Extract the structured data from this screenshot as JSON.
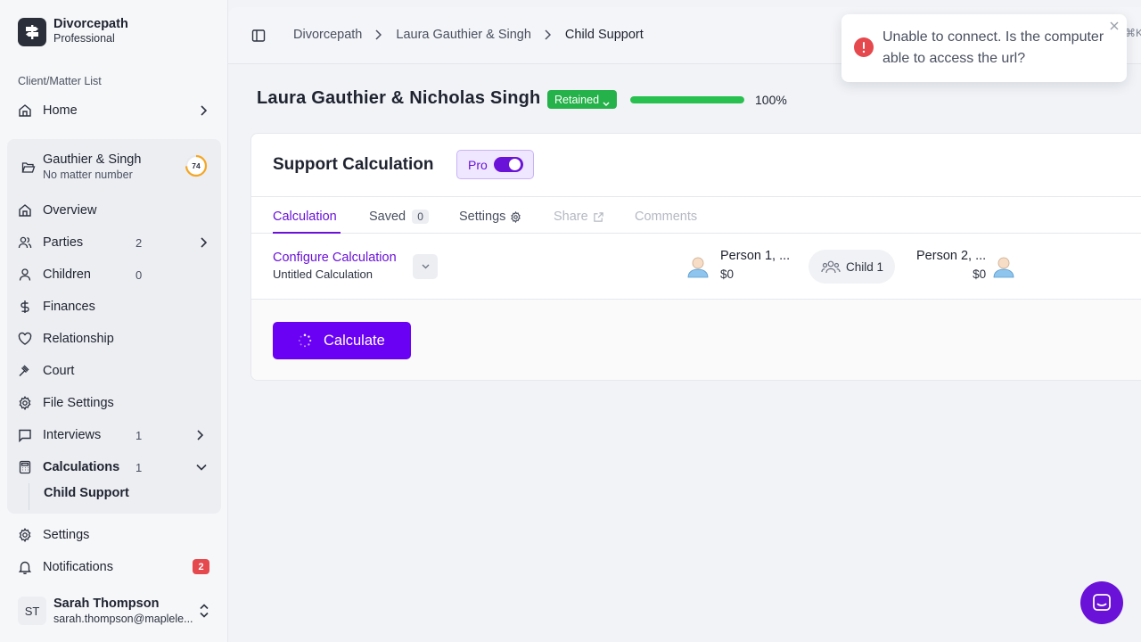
{
  "brand": {
    "name": "Divorcepath",
    "plan": "Professional"
  },
  "sidebar": {
    "section_label": "Client/Matter List",
    "home": "Home",
    "matter": {
      "title": "Gauthier & Singh",
      "subtitle": "No matter number",
      "progress_value": "74"
    },
    "items": [
      {
        "label": "Overview",
        "count": ""
      },
      {
        "label": "Parties",
        "count": "2"
      },
      {
        "label": "Children",
        "count": "0"
      },
      {
        "label": "Finances",
        "count": ""
      },
      {
        "label": "Relationship",
        "count": ""
      },
      {
        "label": "Court",
        "count": ""
      },
      {
        "label": "File Settings",
        "count": ""
      },
      {
        "label": "Interviews",
        "count": "1"
      },
      {
        "label": "Calculations",
        "count": "1"
      }
    ],
    "sub_item": "Child Support",
    "settings": "Settings",
    "notifications": {
      "label": "Notifications",
      "badge": "2"
    },
    "user": {
      "initials": "ST",
      "name": "Sarah Thompson",
      "email": "sarah.thompson@maplele..."
    }
  },
  "topbar": {
    "breadcrumbs": [
      "Divorcepath",
      "Laura Gauthier & Singh",
      "Child Support"
    ],
    "shortcut": "⌘K"
  },
  "case": {
    "title": "Laura Gauthier & Nicholas Singh",
    "status": "Retained",
    "progress_percent": 100,
    "progress_label": "100%"
  },
  "panel": {
    "title": "Support Calculation",
    "pro_label": "Pro",
    "pro_enabled": true,
    "tabs": [
      {
        "label": "Calculation",
        "state": "active"
      },
      {
        "label": "Saved",
        "count": "0"
      },
      {
        "label": "Settings"
      },
      {
        "label": "Share",
        "state": "disabled"
      },
      {
        "label": "Comments",
        "state": "disabled"
      }
    ],
    "config": {
      "title": "Configure Calculation",
      "subtitle": "Untitled Calculation"
    },
    "person1": {
      "name": "Person 1, ...",
      "amount": "$0"
    },
    "child": "Child 1",
    "person2": {
      "name": "Person 2, ...",
      "amount": "$0"
    },
    "calculate_label": "Calculate"
  },
  "toast": {
    "message": "Unable to connect. Is the computer able to access the url?"
  },
  "colors": {
    "accent": "#6a12d8",
    "button": "#6a00f4",
    "success": "#28c04e",
    "error": "#e5484d"
  }
}
